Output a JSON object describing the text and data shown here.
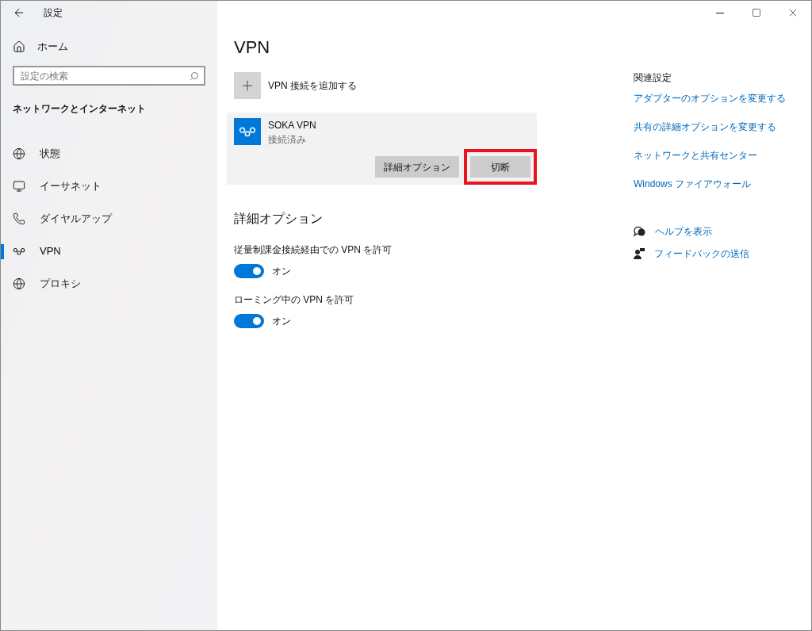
{
  "window": {
    "title": "設定"
  },
  "sidebar": {
    "home": "ホーム",
    "search": {
      "placeholder": "設定の検索"
    },
    "section": "ネットワークとインターネット",
    "items": [
      {
        "label": "状態",
        "kind": "status",
        "selected": false
      },
      {
        "label": "イーサネット",
        "kind": "ethernet",
        "selected": false
      },
      {
        "label": "ダイヤルアップ",
        "kind": "dialup",
        "selected": false
      },
      {
        "label": "VPN",
        "kind": "vpn",
        "selected": true
      },
      {
        "label": "プロキシ",
        "kind": "proxy",
        "selected": false
      }
    ]
  },
  "main": {
    "title": "VPN",
    "add_label": "VPN 接続を追加する",
    "connection": {
      "name": "SOKA VPN",
      "status": "接続済み",
      "buttons": [
        {
          "label": "詳細オプション",
          "highlighted": false
        },
        {
          "label": "切断",
          "highlighted": true
        }
      ]
    },
    "options_heading": "詳細オプション",
    "options": [
      {
        "label": "従量制課金接続経由での VPN を許可",
        "on": true,
        "state": "オン"
      },
      {
        "label": "ローミング中の VPN を許可",
        "on": true,
        "state": "オン"
      }
    ]
  },
  "related": {
    "heading": "関連設定",
    "links": [
      "アダプターのオプションを変更する",
      "共有の詳細オプションを変更する",
      "ネットワークと共有センター",
      "Windows ファイアウォール"
    ],
    "help": [
      {
        "kind": "help",
        "label": "ヘルプを表示"
      },
      {
        "kind": "feedback",
        "label": "フィードバックの送信"
      }
    ]
  }
}
